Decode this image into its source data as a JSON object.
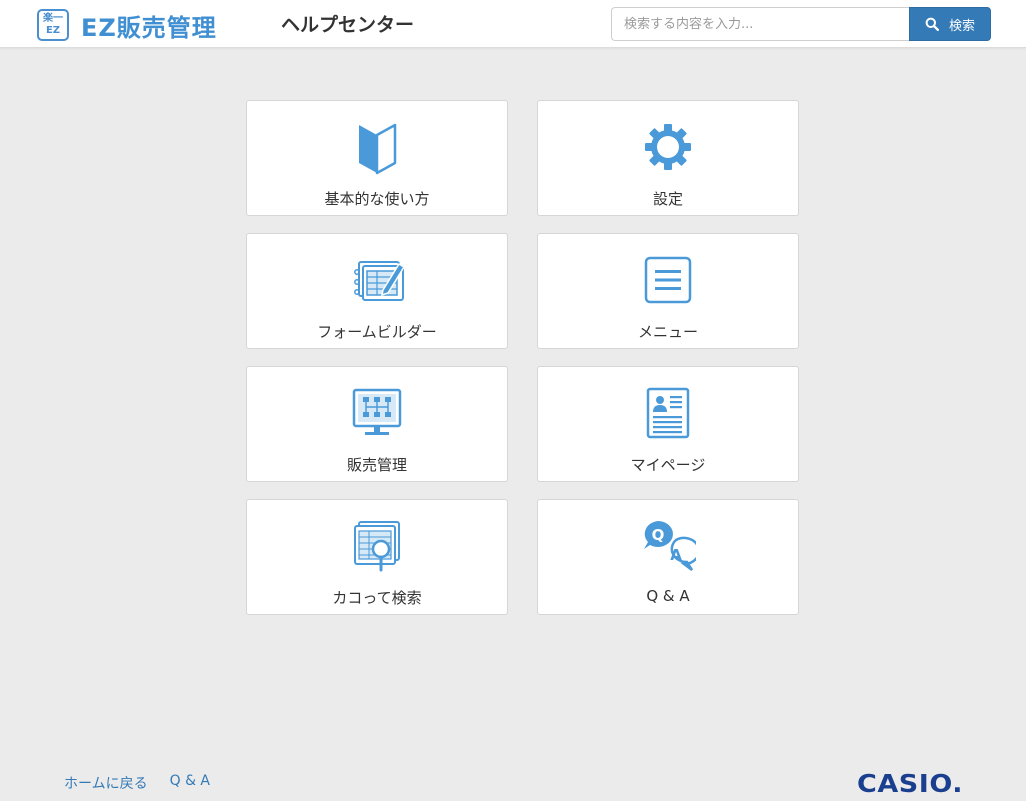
{
  "header": {
    "logo_badge_top": "楽一",
    "logo_badge_bottom": "EZ",
    "logo_text": "EZ販売管理",
    "title": "ヘルプセンター",
    "search_placeholder": "検索する内容を入力...",
    "search_button_label": "検索"
  },
  "cards": [
    {
      "label": "基本的な使い方",
      "icon": "beginner-mark-icon"
    },
    {
      "label": "設定",
      "icon": "gear-icon"
    },
    {
      "label": "フォームビルダー",
      "icon": "form-builder-icon"
    },
    {
      "label": "メニュー",
      "icon": "menu-icon"
    },
    {
      "label": "販売管理",
      "icon": "sales-monitor-icon"
    },
    {
      "label": "マイページ",
      "icon": "profile-document-icon"
    },
    {
      "label": "カコって検索",
      "icon": "document-search-icon"
    },
    {
      "label": "Q & A",
      "icon": "qa-bubbles-icon"
    }
  ],
  "footer": {
    "home_link": "ホームに戻る",
    "qa_link": "Q & A",
    "brand": "CASIO."
  },
  "colors": {
    "accent": "#4a9ad9",
    "button": "#337ab7",
    "background": "#ebebeb"
  }
}
